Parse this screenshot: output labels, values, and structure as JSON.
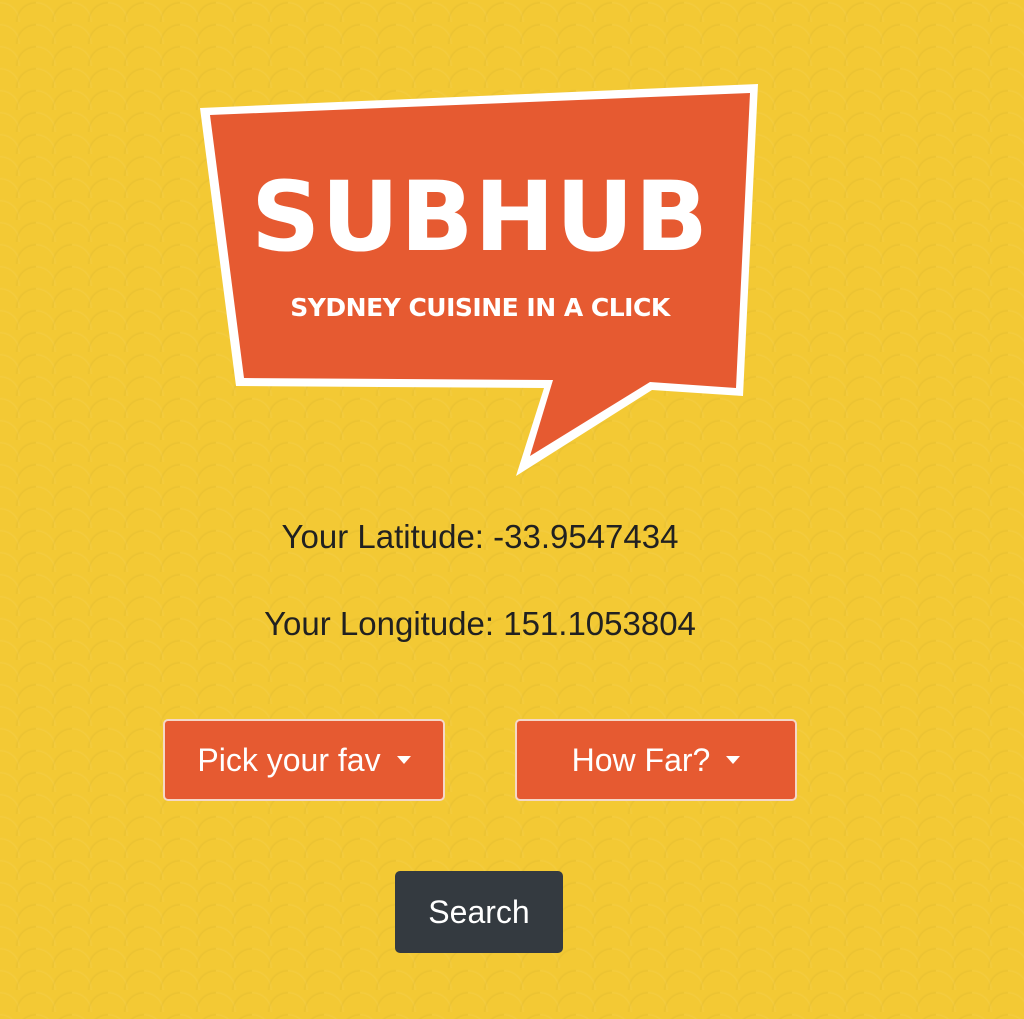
{
  "logo": {
    "title": "SUBHUB",
    "tagline": "SYDNEY CUISINE IN A CLICK",
    "color": "#e65a31"
  },
  "location": {
    "latitude_label": "Your Latitude: -33.9547434",
    "longitude_label": "Your Longitude: 151.1053804"
  },
  "filters": {
    "favourite": {
      "label": "Pick your fav",
      "icon": "caret-down-icon"
    },
    "distance": {
      "label": "How Far?",
      "icon": "caret-down-icon"
    }
  },
  "search": {
    "label": "Search"
  },
  "colors": {
    "background": "#f3c934",
    "accent": "#e65a31",
    "dark_button": "#343a40"
  }
}
